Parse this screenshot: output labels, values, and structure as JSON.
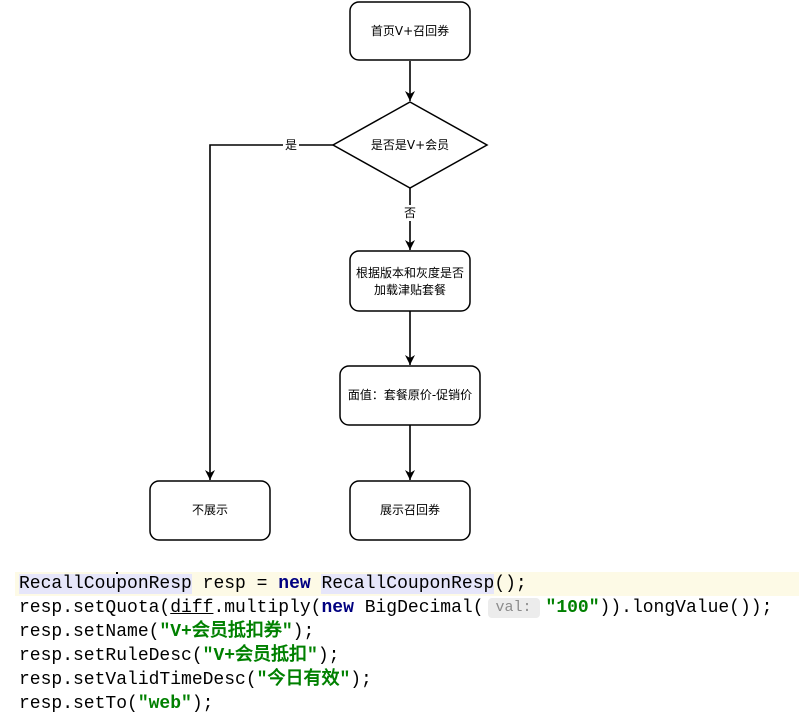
{
  "flowchart": {
    "start": {
      "label": "首页V+召回券"
    },
    "decision": {
      "label": "是否是V+会员"
    },
    "edge_yes": "是",
    "edge_no": "否",
    "allowance_check": {
      "label_lines": [
        "根据版本和灰度是否",
        "加载津贴套餐"
      ]
    },
    "face_value": {
      "label": "面值：套餐原价-促销价"
    },
    "show_coupon": {
      "label": "展示召回券"
    },
    "hide": {
      "label": "不展示"
    }
  },
  "code": {
    "colors": {
      "keyword": "#000080",
      "string": "#008000",
      "class_highlight": "#e6e6fa",
      "current_line": "#fdfae6",
      "hint_bg": "#ececec",
      "hint_fg": "#8c8c8c"
    },
    "lines": [
      {
        "current": true,
        "tokens": [
          {
            "t": "RecallCou",
            "k": "class"
          },
          {
            "k": "caret"
          },
          {
            "t": "ponResp",
            "k": "class"
          },
          {
            "t": " resp = ",
            "k": "plain"
          },
          {
            "t": "new",
            "k": "keyword"
          },
          {
            "t": " ",
            "k": "plain"
          },
          {
            "t": "RecallCouponResp",
            "k": "class"
          },
          {
            "t": "();",
            "k": "plain"
          }
        ]
      },
      {
        "current": false,
        "tokens": [
          {
            "t": "resp.setQuota(",
            "k": "plain"
          },
          {
            "t": "diff",
            "k": "underline"
          },
          {
            "t": ".multiply(",
            "k": "plain"
          },
          {
            "t": "new",
            "k": "keyword"
          },
          {
            "t": " BigDecimal(",
            "k": "plain"
          },
          {
            "t": "val:",
            "k": "hint"
          },
          {
            "t": "\"100\"",
            "k": "string"
          },
          {
            "t": ")).longValue());",
            "k": "plain"
          }
        ]
      },
      {
        "current": false,
        "tokens": [
          {
            "t": "resp.setName(",
            "k": "plain"
          },
          {
            "t": "\"V+会员抵扣券\"",
            "k": "string"
          },
          {
            "t": ");",
            "k": "plain"
          }
        ]
      },
      {
        "current": false,
        "tokens": [
          {
            "t": "resp.setRuleDesc(",
            "k": "plain"
          },
          {
            "t": "\"V+会员抵扣\"",
            "k": "string"
          },
          {
            "t": ");",
            "k": "plain"
          }
        ]
      },
      {
        "current": false,
        "tokens": [
          {
            "t": "resp.setValidTimeDesc(",
            "k": "plain"
          },
          {
            "t": "\"今日有效\"",
            "k": "string"
          },
          {
            "t": ");",
            "k": "plain"
          }
        ]
      },
      {
        "current": false,
        "tokens": [
          {
            "t": "resp.setTo(",
            "k": "plain"
          },
          {
            "t": "\"web\"",
            "k": "string"
          },
          {
            "t": ");",
            "k": "plain"
          }
        ]
      }
    ]
  }
}
